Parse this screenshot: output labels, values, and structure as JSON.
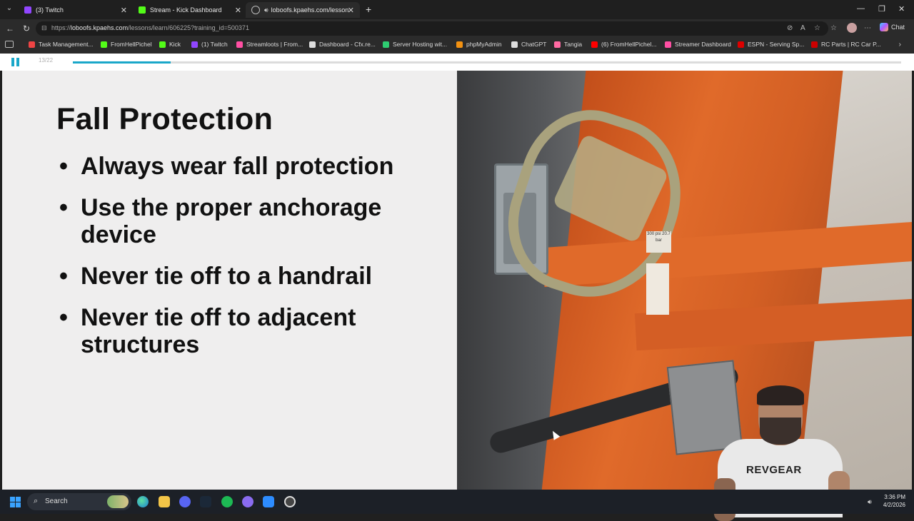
{
  "browser": {
    "tabs": [
      {
        "label": "(3) Twitch",
        "color": "#9146ff",
        "active": false
      },
      {
        "label": "Stream - Kick Dashboard",
        "color": "#53fc18",
        "active": false
      },
      {
        "label": "loboofs.kpaehs.com/lessons/l",
        "color": "#8ab4f8",
        "active": true
      }
    ],
    "url": {
      "prefix": "https://",
      "host": "loboofs.kpaehs.com",
      "path": "/lessons/learn/606225?training_id=500371"
    },
    "chat_label": "Chat",
    "bookmarks": [
      {
        "label": "Task Management...",
        "color": "#e44"
      },
      {
        "label": "FromHellPichel",
        "color": "#53fc18"
      },
      {
        "label": "Kick",
        "color": "#53fc18"
      },
      {
        "label": "(1) Twitch",
        "color": "#9146ff"
      },
      {
        "label": "Streamloots | From...",
        "color": "#ff4fa3"
      },
      {
        "label": "Dashboard - Cfx.re...",
        "color": "#ddd"
      },
      {
        "label": "Server Hosting wit...",
        "color": "#2ecc71"
      },
      {
        "label": "phpMyAdmin",
        "color": "#f29111"
      },
      {
        "label": "ChatGPT",
        "color": "#ddd"
      },
      {
        "label": "Tangia",
        "color": "#ff6aa2"
      },
      {
        "label": "(6) FromHellPichel...",
        "color": "#ff0000"
      },
      {
        "label": "Streamer Dashboard",
        "color": "#ff4fa3"
      },
      {
        "label": "ESPN - Serving Sp...",
        "color": "#d00"
      },
      {
        "label": "RC Parts | RC Car P...",
        "color": "#c00"
      }
    ]
  },
  "player": {
    "counter": "13/22",
    "progress_fraction": 0.118
  },
  "slide": {
    "title": "Fall Protection",
    "bullets": [
      "Always wear fall protection",
      "Use the proper anchorage device",
      "Never tie off to a handrail",
      "Never tie off to adjacent structures"
    ],
    "photo_labels": {
      "pressure": "300 psi 20.7 bar"
    }
  },
  "webcam": {
    "shirt_text": "REVGEAR"
  },
  "taskbar": {
    "search_label": "Search",
    "time": "3:36 PM",
    "date": "4/2/2026"
  }
}
